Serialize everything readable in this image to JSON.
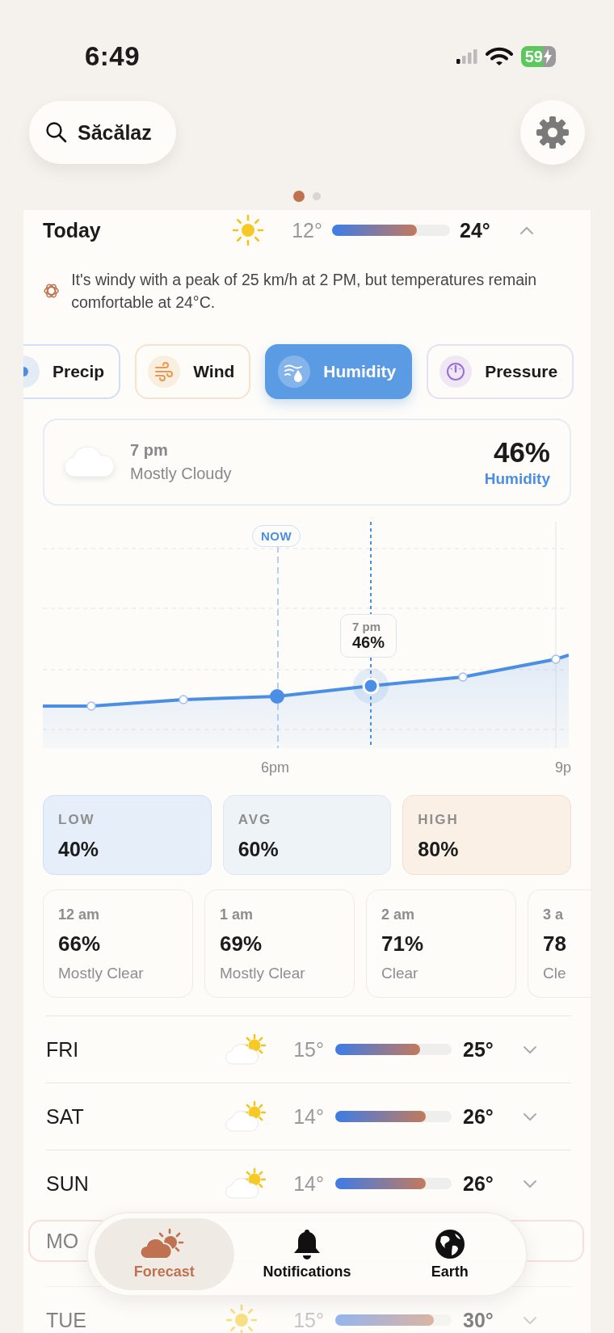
{
  "status_bar": {
    "time": "6:49",
    "battery": "59"
  },
  "search": {
    "value": "Săcălaz"
  },
  "page_dots": [
    {
      "selected": true
    },
    {
      "selected": false
    }
  ],
  "today": {
    "label": "Today",
    "low": "12°",
    "high": "24°",
    "level": 0.72,
    "expanded": true,
    "summary": "It's windy with a peak of 25 km/h at 2 PM, but temperatures remain comfortable at 24°C."
  },
  "metric_tabs": [
    {
      "label": "Precip",
      "kind": "precip",
      "selected": false
    },
    {
      "label": "Wind",
      "kind": "wind",
      "selected": false
    },
    {
      "label": "Humidity",
      "kind": "humidity",
      "selected": true
    },
    {
      "label": "Pressure",
      "kind": "pressure",
      "selected": false
    }
  ],
  "selected_hour": {
    "time": "7 pm",
    "condition": "Mostly Cloudy",
    "value": "46%",
    "metric": "Humidity"
  },
  "chart": {
    "now_label": "NOW",
    "tooltip_time": "7 pm",
    "tooltip_value": "46%",
    "x_labels": [
      "6pm",
      "9p"
    ]
  },
  "stats": [
    {
      "label": "LOW",
      "value": "40%",
      "kind": "low"
    },
    {
      "label": "AVG",
      "value": "60%",
      "kind": "avg"
    },
    {
      "label": "HIGH",
      "value": "80%",
      "kind": "high"
    }
  ],
  "hourly": [
    {
      "time": "12 am",
      "value": "66%",
      "condition": "Mostly Clear"
    },
    {
      "time": "1 am",
      "value": "69%",
      "condition": "Mostly Clear"
    },
    {
      "time": "2 am",
      "value": "71%",
      "condition": "Clear"
    },
    {
      "time": "3 a",
      "value": "78",
      "condition": "Cle"
    }
  ],
  "daily": [
    {
      "kind": "cloudy",
      "day": "FRI",
      "low": "15°",
      "high": "25°",
      "level": 0.73,
      "expanded": false,
      "highlighted": false,
      "dimmed": false
    },
    {
      "kind": "cloudy",
      "day": "SAT",
      "low": "14°",
      "high": "26°",
      "level": 0.78,
      "expanded": false,
      "highlighted": false,
      "dimmed": false
    },
    {
      "kind": "cloudy",
      "day": "SUN",
      "low": "14°",
      "high": "26°",
      "level": 0.78,
      "expanded": false,
      "highlighted": false,
      "dimmed": false
    },
    {
      "kind": "partial",
      "day": "MO",
      "highlighted": true,
      "dimmed": true
    },
    {
      "kind": "sunny",
      "day": "TUE",
      "low": "15°",
      "high": "30°",
      "level": 0.85,
      "expanded": false,
      "highlighted": false,
      "dimmed": true
    }
  ],
  "tab_bar": [
    {
      "label": "Forecast",
      "selected": true
    },
    {
      "label": "Notifications",
      "selected": false
    },
    {
      "label": "Earth",
      "selected": false
    }
  ]
}
